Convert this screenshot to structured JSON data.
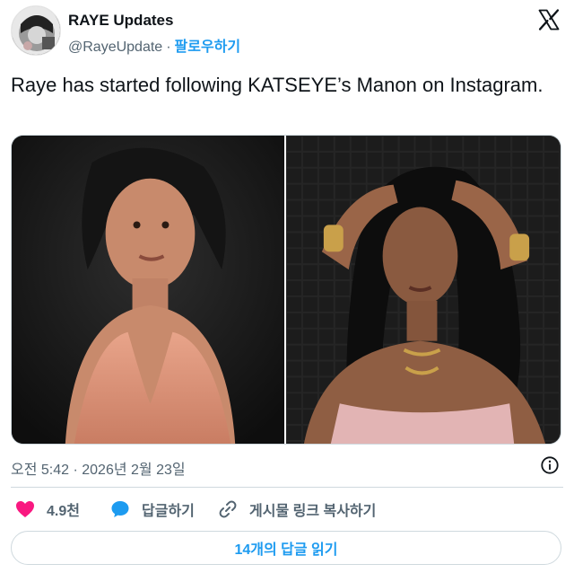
{
  "account": {
    "display_name": "RAYE Updates",
    "handle": "@RayeUpdate",
    "separator": "·",
    "follow_label": "팔로우하기"
  },
  "tweet": {
    "text": "Raye has started following KATSEYE’s Manon on Instagram."
  },
  "media": {
    "images": [
      {
        "icon": "photo-raye"
      },
      {
        "icon": "photo-manon"
      }
    ]
  },
  "meta": {
    "timestamp": "오전 5:42 · 2026년 2월 23일"
  },
  "actions": {
    "like_count": "4.9천",
    "reply_label": "답글하기",
    "copy_link_label": "게시물 링크 복사하기"
  },
  "replies_button": {
    "label": "14개의 답글 읽기"
  },
  "colors": {
    "accent": "#1d9bf0",
    "like": "#f91880",
    "muted": "#536471",
    "text": "#0f1419",
    "border": "#cfd9de"
  }
}
